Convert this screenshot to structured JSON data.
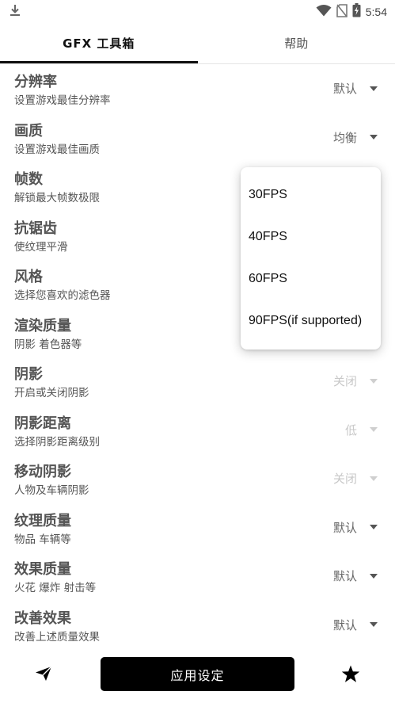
{
  "status_bar": {
    "time": "5:54",
    "icons": [
      "download-icon",
      "wifi-icon",
      "no-sim-icon",
      "battery-charging-icon"
    ]
  },
  "tabs": [
    {
      "label": "GFX 工具箱",
      "active": true
    },
    {
      "label": "帮助",
      "active": false
    }
  ],
  "settings": [
    {
      "title": "分辨率",
      "subtitle": "设置游戏最佳分辨率",
      "value": "默认",
      "enabled": true
    },
    {
      "title": "画质",
      "subtitle": "设置游戏最佳画质",
      "value": "均衡",
      "enabled": true
    },
    {
      "title": "帧数",
      "subtitle": "解锁最大帧数极限",
      "value": "",
      "enabled": true
    },
    {
      "title": "抗锯齿",
      "subtitle": "使纹理平滑",
      "value": "",
      "enabled": true
    },
    {
      "title": "风格",
      "subtitle": "选择您喜欢的滤色器",
      "value": "",
      "enabled": true
    },
    {
      "title": "渲染质量",
      "subtitle": "阴影 着色器等",
      "value": "",
      "enabled": true
    },
    {
      "title": "阴影",
      "subtitle": "开启或关闭阴影",
      "value": "关闭",
      "enabled": false
    },
    {
      "title": "阴影距离",
      "subtitle": "选择阴影距离级别",
      "value": "低",
      "enabled": false
    },
    {
      "title": "移动阴影",
      "subtitle": "人物及车辆阴影",
      "value": "关闭",
      "enabled": false
    },
    {
      "title": "纹理质量",
      "subtitle": "物品 车辆等",
      "value": "默认",
      "enabled": true
    },
    {
      "title": "效果质量",
      "subtitle": "火花 爆炸 射击等",
      "value": "默认",
      "enabled": true
    },
    {
      "title": "改善效果",
      "subtitle": "改善上述质量效果",
      "value": "默认",
      "enabled": true
    }
  ],
  "fps_dropdown": {
    "options": [
      "30FPS",
      "40FPS",
      "60FPS",
      "90FPS(if supported)"
    ]
  },
  "bottom_bar": {
    "apply_label": "应用设定",
    "left_icon": "send-icon",
    "right_icon": "star-icon"
  }
}
